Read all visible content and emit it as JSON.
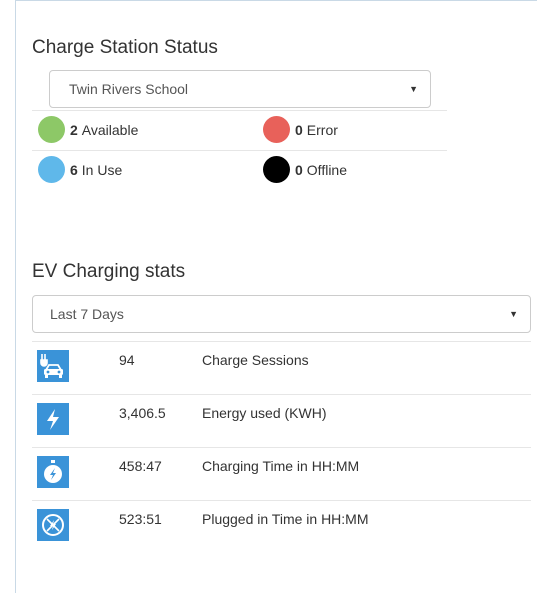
{
  "station_status": {
    "title": "Charge Station Status",
    "site_select": {
      "value": "Twin Rivers School"
    },
    "statuses": [
      {
        "count": "2",
        "label": "Available",
        "color": "#8dc867"
      },
      {
        "count": "0",
        "label": "Error",
        "color": "#e8615a"
      },
      {
        "count": "6",
        "label": "In Use",
        "color": "#5fb8ea"
      },
      {
        "count": "0",
        "label": "Offline",
        "color": "#000000"
      }
    ]
  },
  "ev_stats": {
    "title": "EV Charging stats",
    "period_select": {
      "value": "Last 7 Days"
    },
    "rows": [
      {
        "icon": "car-plug-icon",
        "value": "94",
        "label": "Charge Sessions"
      },
      {
        "icon": "lightning-bolt-icon",
        "value": "3,406.5",
        "label": "Energy used (KWH)"
      },
      {
        "icon": "stopwatch-bolt-icon",
        "value": "458:47",
        "label": "Charging Time in HH:MM"
      },
      {
        "icon": "circle-plug-icon",
        "value": "523:51",
        "label": "Plugged in Time in HH:MM"
      }
    ]
  },
  "colors": {
    "icon_bg": "#3a93d8",
    "border": "#c9d9e6"
  }
}
